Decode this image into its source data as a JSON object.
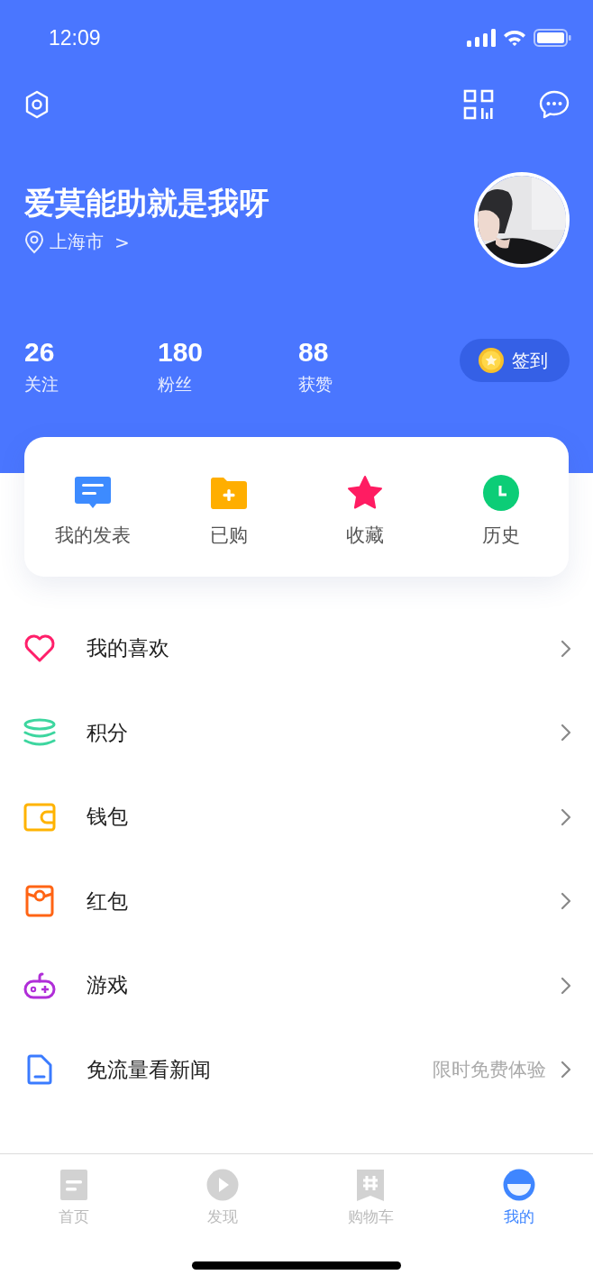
{
  "status_bar": {
    "time": "12:09"
  },
  "profile": {
    "name": "爱莫能助就是我呀",
    "location": "上海市",
    "location_arrow": ">"
  },
  "stats": [
    {
      "value": "26",
      "label": "关注"
    },
    {
      "value": "180",
      "label": "粉丝"
    },
    {
      "value": "88",
      "label": "获赞"
    }
  ],
  "checkin": {
    "label": "签到"
  },
  "shortcuts": [
    {
      "label": "我的发表"
    },
    {
      "label": "已购"
    },
    {
      "label": "收藏"
    },
    {
      "label": "历史"
    }
  ],
  "menu": [
    {
      "label": "我的喜欢"
    },
    {
      "label": "积分"
    },
    {
      "label": "钱包"
    },
    {
      "label": "红包"
    },
    {
      "label": "游戏"
    },
    {
      "label": "免流量看新闻",
      "note": "限时免费体验"
    }
  ],
  "tabs": [
    {
      "label": "首页",
      "selected": false
    },
    {
      "label": "发现",
      "selected": false
    },
    {
      "label": "购物车",
      "selected": false
    },
    {
      "label": "我的",
      "selected": true
    }
  ]
}
